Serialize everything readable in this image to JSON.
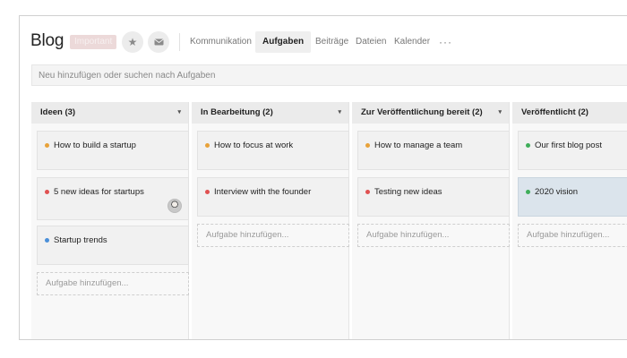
{
  "header": {
    "title": "Blog",
    "badge": "Important",
    "star_icon": "star-icon",
    "mail_icon": "mail-icon",
    "tabs": [
      {
        "label": "Kommunikation",
        "active": false
      },
      {
        "label": "Aufgaben",
        "active": true
      },
      {
        "label": "Beiträge",
        "active": false
      },
      {
        "label": "Dateien",
        "active": false
      },
      {
        "label": "Kalender",
        "active": false
      }
    ],
    "more": "···"
  },
  "search": {
    "placeholder": "Neu hinzufügen oder suchen nach Aufgaben"
  },
  "columns": [
    {
      "title": "Ideen (3)",
      "caret": "▾",
      "cards": [
        {
          "text": "How to build a startup",
          "dot_color": "#e8a23a"
        },
        {
          "text": "5 new ideas for startups",
          "dot_color": "#e05151",
          "avatar": true
        },
        {
          "text": "Startup trends",
          "dot_color": "#4a8fd9"
        }
      ],
      "add_label": "Aufgabe hinzufügen..."
    },
    {
      "title": "In Bearbeitung (2)",
      "caret": "▾",
      "cards": [
        {
          "text": "How to focus at work",
          "dot_color": "#e8a23a"
        },
        {
          "text": "Interview with the founder",
          "dot_color": "#e05151"
        }
      ],
      "add_label": "Aufgabe hinzufügen..."
    },
    {
      "title": "Zur Veröffentlichung bereit (2)",
      "caret": "▾",
      "cards": [
        {
          "text": "How to manage a team",
          "dot_color": "#e8a23a"
        },
        {
          "text": "Testing new ideas",
          "dot_color": "#e05151"
        }
      ],
      "add_label": "Aufgabe hinzufügen..."
    },
    {
      "title": "Veröffentlicht (2)",
      "cards": [
        {
          "text": "Our first blog post",
          "dot_color": "#3fae5a"
        },
        {
          "text": "2020 vision",
          "dot_color": "#3fae5a",
          "selected": true
        }
      ],
      "add_label": "Aufgabe hinzufügen..."
    }
  ]
}
